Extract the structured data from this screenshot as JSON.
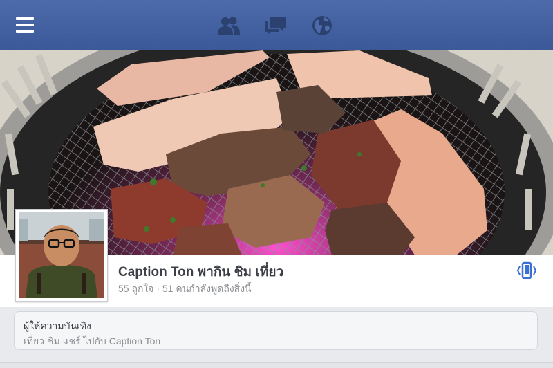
{
  "header": {
    "menu_icon": "hamburger-menu-icon",
    "nav_icons": [
      "friend-requests-icon",
      "messages-icon",
      "notifications-globe-icon"
    ],
    "bar_color": "#3b5998"
  },
  "cover": {
    "subject": "grilled-meat-cover-photo"
  },
  "profile": {
    "name": "Caption Ton พากิน ชิม เที่ยว",
    "stats": "55 ถูกใจ · 51 คนกำลังพูดถึงสิ่งนี้",
    "action_icon": "vibrate-phone-icon"
  },
  "category": {
    "title": "ผู้ให้ความบันเทิง",
    "subtitle": "เที่ยว ชิม แชร์ ไปกับ Caption Ton"
  }
}
